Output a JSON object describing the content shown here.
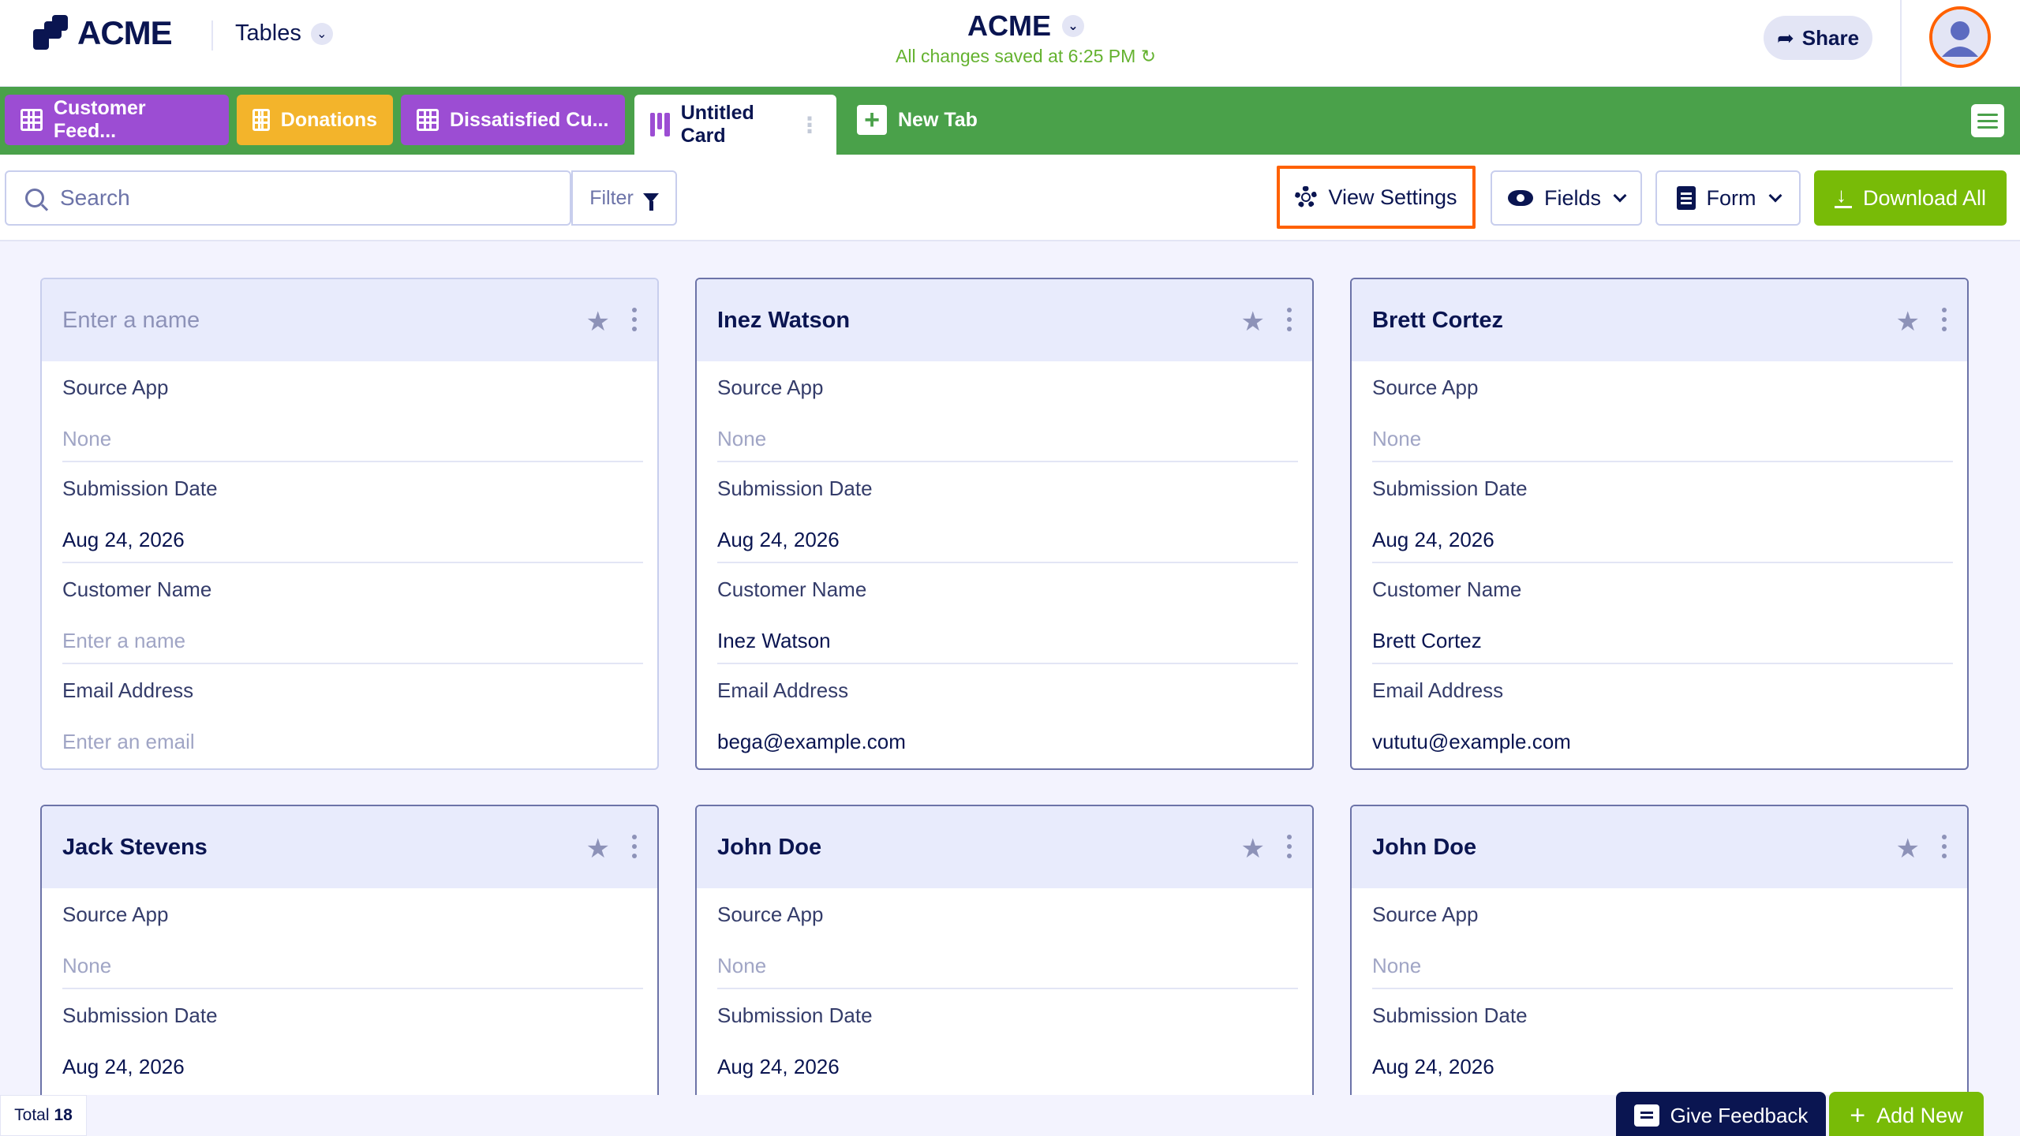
{
  "header": {
    "logo_text": "ACME",
    "tables_label": "Tables",
    "app_title": "ACME",
    "saved_status": "All changes saved at 6:25 PM",
    "share_label": "Share"
  },
  "tabs": [
    {
      "label": "Customer Feed...",
      "color": "#9c4dd3",
      "icon": "table-grid-icon"
    },
    {
      "label": "Donations",
      "color": "#f3b42b",
      "icon": "table-grid-icon"
    },
    {
      "label": "Dissatisfied Cu...",
      "color": "#9c4dd3",
      "icon": "table-grid-icon"
    },
    {
      "label": "Untitled Card",
      "color": "#ffffff",
      "icon": "card-view-icon",
      "active": true
    },
    {
      "label": "New Tab",
      "icon": "plus-icon"
    }
  ],
  "toolbar": {
    "search_placeholder": "Search",
    "filter_label": "Filter",
    "view_settings_label": "View Settings",
    "fields_label": "Fields",
    "form_label": "Form",
    "download_label": "Download All"
  },
  "field_labels": {
    "source_app": "Source App",
    "submission_date": "Submission Date",
    "customer_name": "Customer Name",
    "email_address": "Email Address"
  },
  "cards": [
    {
      "title": "Enter a name",
      "placeholder": true,
      "source_app": "None",
      "submission_date": "Aug 24, 2026",
      "customer_name": "Enter a name",
      "email": "Enter an email"
    },
    {
      "title": "Inez Watson",
      "source_app": "None",
      "submission_date": "Aug 24, 2026",
      "customer_name": "Inez Watson",
      "email": "bega@example.com"
    },
    {
      "title": "Brett Cortez",
      "source_app": "None",
      "submission_date": "Aug 24, 2026",
      "customer_name": "Brett Cortez",
      "email": "vututu@example.com"
    },
    {
      "title": "Jack Stevens",
      "source_app": "None",
      "submission_date": "Aug 24, 2026"
    },
    {
      "title": "John Doe",
      "source_app": "None",
      "submission_date": "Aug 24, 2026"
    },
    {
      "title": "John Doe",
      "source_app": "None",
      "submission_date": "Aug 24, 2026"
    }
  ],
  "footer": {
    "total_label": "Total",
    "total_count": "18",
    "feedback_label": "Give Feedback",
    "add_new_label": "Add New"
  },
  "colors": {
    "accent_green": "#4aa14a",
    "download_green": "#78bb07",
    "navy": "#0a1551",
    "highlight_orange": "#ff6100",
    "purple": "#9c4dd3",
    "yellow": "#f3b42b"
  }
}
